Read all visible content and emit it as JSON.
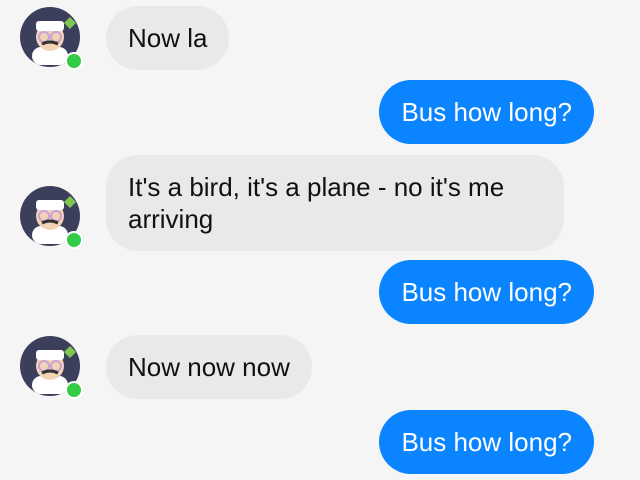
{
  "contact": {
    "online_status_color": "#33cc44"
  },
  "colors": {
    "incoming_bubble": "#e9e9e9",
    "outgoing_bubble": "#0a84ff",
    "background": "#f5f5f5"
  },
  "messages": [
    {
      "from": "contact",
      "text": "Now la"
    },
    {
      "from": "me",
      "text": "Bus how long?"
    },
    {
      "from": "contact",
      "line1": "It's a bird, it's a plane - no it's me",
      "line2": "arriving"
    },
    {
      "from": "me",
      "text": "Bus how long?"
    },
    {
      "from": "contact",
      "text": "Now now now"
    },
    {
      "from": "me",
      "text": "Bus how long?"
    }
  ]
}
